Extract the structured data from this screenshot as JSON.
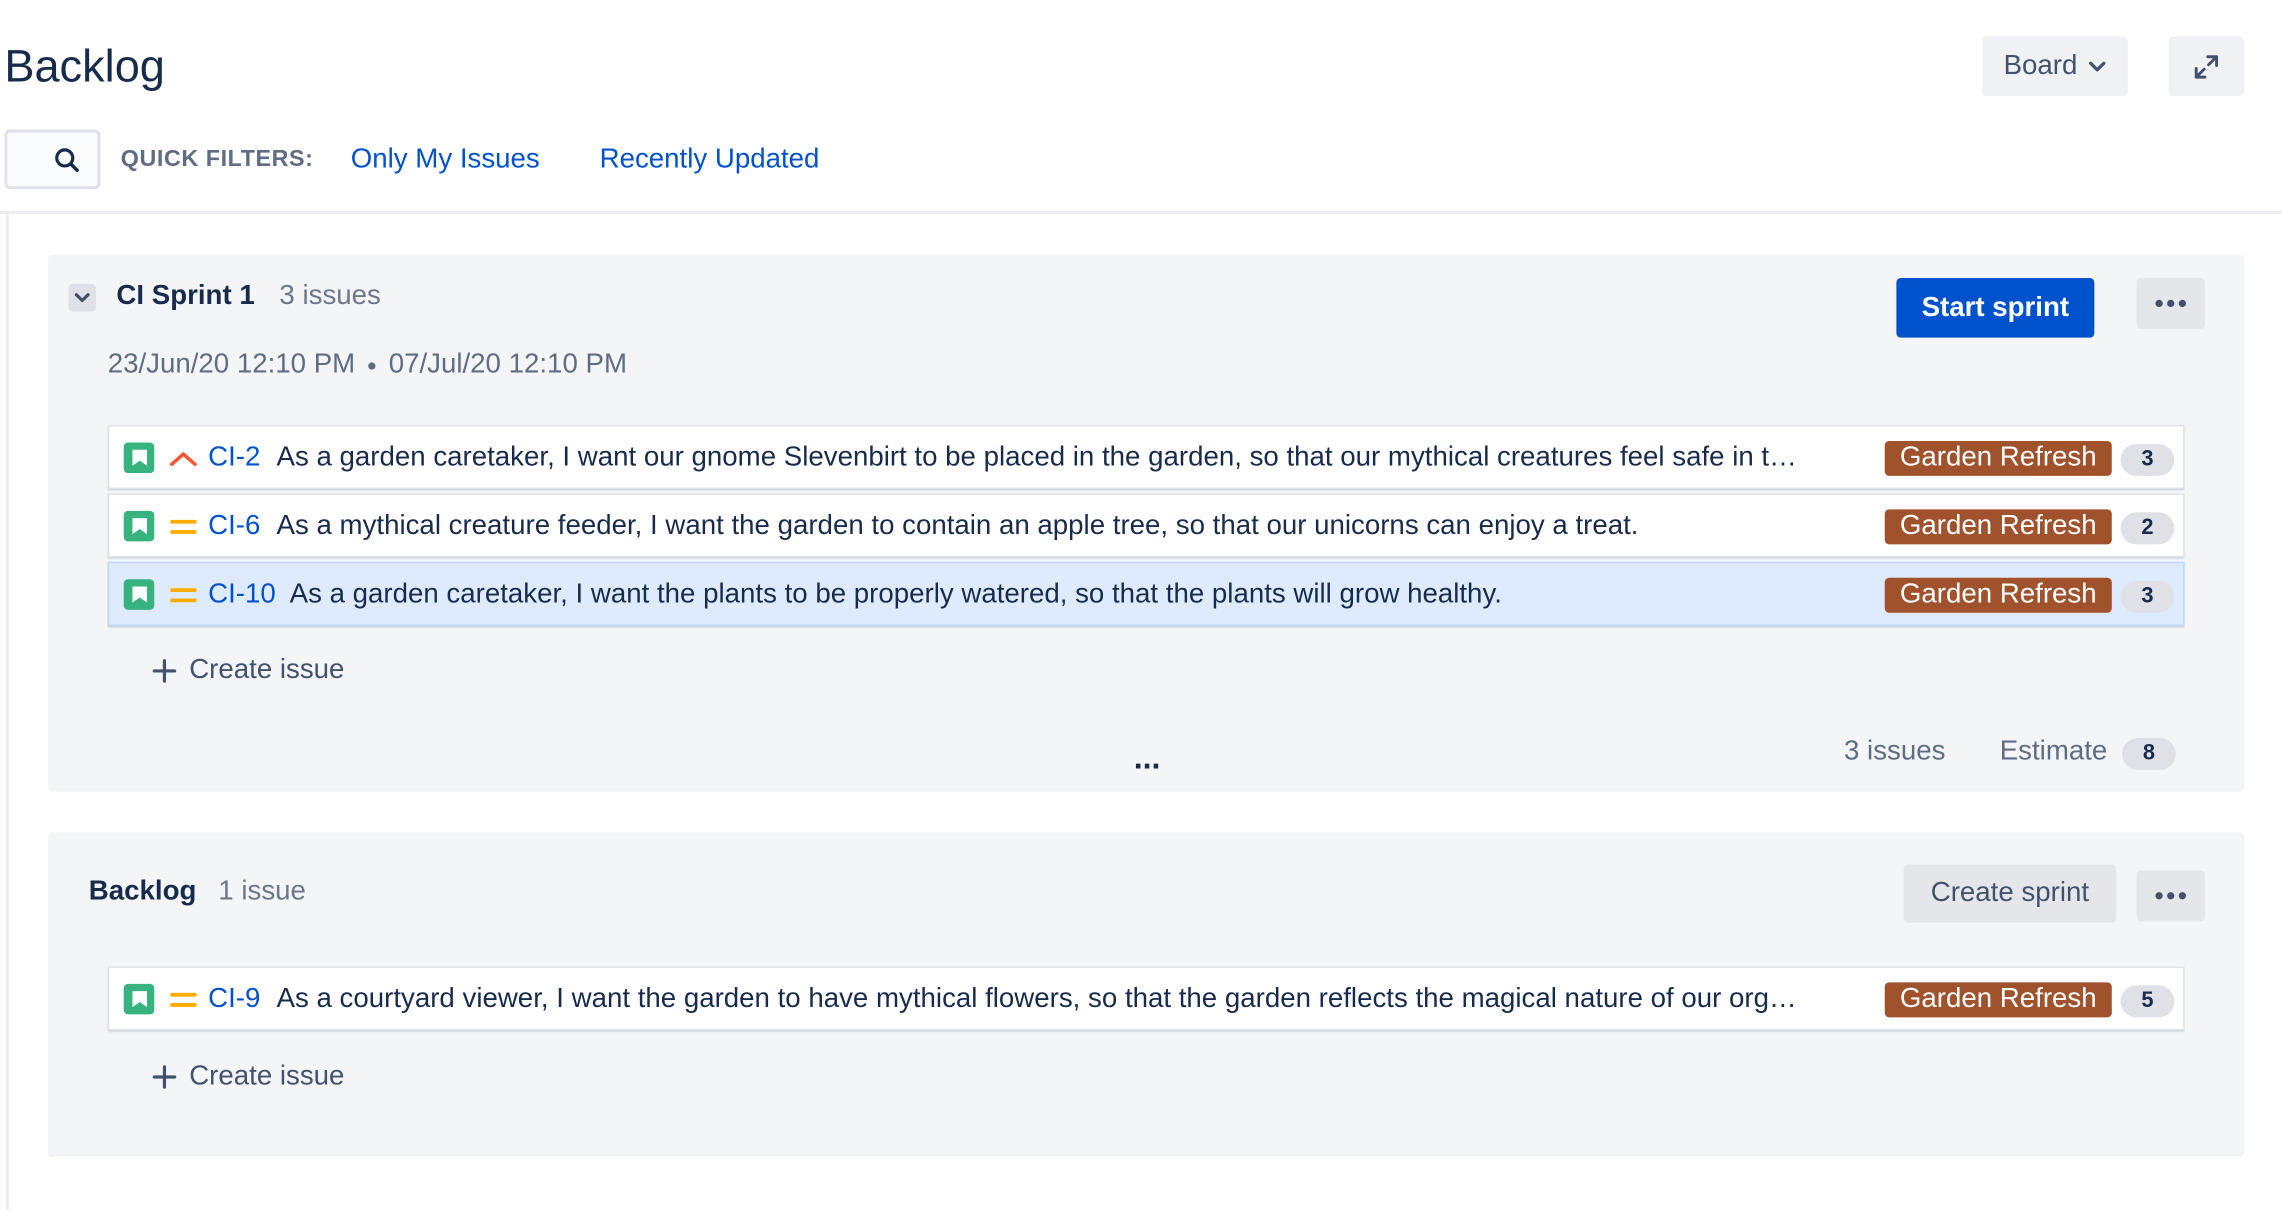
{
  "header": {
    "title": "Backlog",
    "board_button": "Board",
    "expand_icon": "expand-icon",
    "quick_filters_label": "QUICK FILTERS:",
    "quick_filters": [
      "Only My Issues",
      "Recently Updated"
    ],
    "search_icon": "search-icon"
  },
  "sprint": {
    "name": "CI Sprint 1",
    "issue_count": "3 issues",
    "start_date": "23/Jun/20 12:10 PM",
    "end_date": "07/Jul/20 12:10 PM",
    "start_button": "Start sprint",
    "issues": [
      {
        "key": "CI-2",
        "priority": "high",
        "summary": "As a garden caretaker, I want our gnome Slevenbirt to be placed in the garden, so that our mythical creatures feel safe in t…",
        "epic": "Garden Refresh",
        "estimate": "3",
        "selected": false
      },
      {
        "key": "CI-6",
        "priority": "medium",
        "summary": "As a mythical creature feeder, I want the garden to contain an apple tree, so that our unicorns can enjoy a treat.",
        "epic": "Garden Refresh",
        "estimate": "2",
        "selected": false
      },
      {
        "key": "CI-10",
        "priority": "medium",
        "summary": "As a garden caretaker, I want the plants to be properly watered, so that the plants will grow healthy.",
        "epic": "Garden Refresh",
        "estimate": "3",
        "selected": true
      }
    ],
    "create_issue": "Create issue",
    "footer_ellipsis": "...",
    "footer_issue_count": "3 issues",
    "footer_estimate_label": "Estimate",
    "footer_estimate_total": "8"
  },
  "backlog": {
    "name": "Backlog",
    "issue_count": "1 issue",
    "create_sprint_button": "Create sprint",
    "issues": [
      {
        "key": "CI-9",
        "priority": "medium",
        "summary": "As a courtyard viewer, I want the garden to have mythical flowers, so that the garden reflects the magical nature of our org…",
        "epic": "Garden Refresh",
        "estimate": "5",
        "selected": false
      }
    ],
    "create_issue": "Create issue"
  },
  "colors": {
    "link": "#0052cc",
    "primary_button": "#0052cc",
    "story_icon": "#36b37e",
    "priority_high": "#ff5630",
    "priority_medium": "#ffab00",
    "epic_label": "#a0522d",
    "selected_row": "#deebff",
    "panel": "#f4f5f7"
  }
}
